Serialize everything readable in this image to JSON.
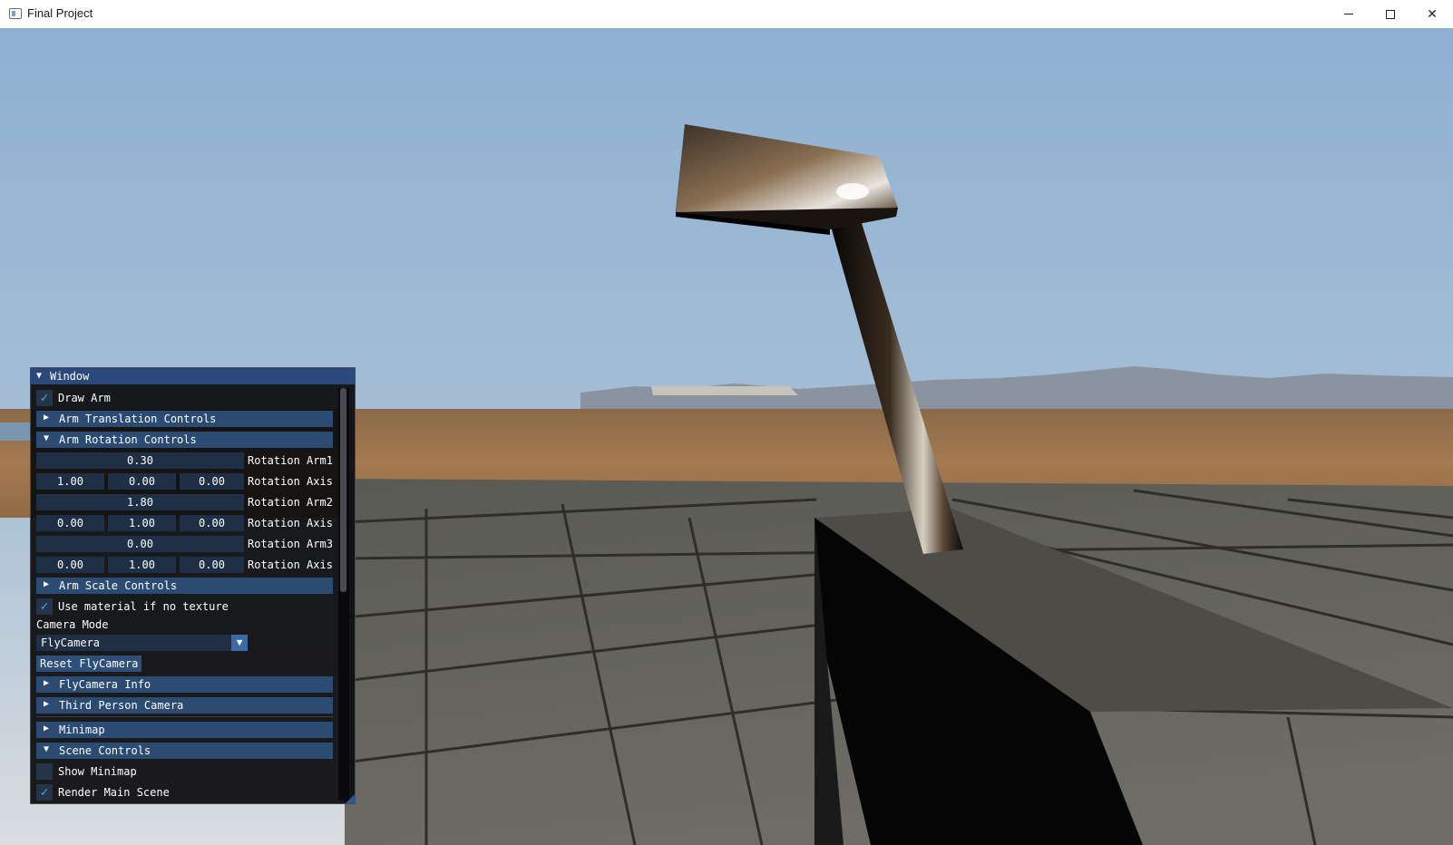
{
  "window": {
    "title": "Final Project",
    "minimize_symbol": "─",
    "maximize_symbol": "☐",
    "close_symbol": "✕"
  },
  "colors": {
    "imgui_header": "#2b4b73",
    "imgui_title": "#294a7a",
    "checkmark": "#4aa3ff",
    "sky_top": "#8fb1d2",
    "sky_horizon": "#d7dce2"
  },
  "imgui": {
    "title": "Window",
    "title_arrow": "▼",
    "draw_arm": {
      "label": "Draw Arm",
      "checked": true,
      "mark": "✓"
    },
    "arm_translation": {
      "label": "Arm Translation Controls",
      "arrow": "▶"
    },
    "arm_rotation": {
      "label": "Arm Rotation Controls",
      "arrow": "▼",
      "rows": [
        {
          "value": "0.30",
          "label": "Rotation Arm1"
        },
        {
          "values": [
            "1.00",
            "0.00",
            "0.00"
          ],
          "label": "Rotation Axis"
        },
        {
          "value": "1.80",
          "label": "Rotation Arm2"
        },
        {
          "values": [
            "0.00",
            "1.00",
            "0.00"
          ],
          "label": "Rotation Axis"
        },
        {
          "value": "0.00",
          "label": "Rotation Arm3"
        },
        {
          "values": [
            "0.00",
            "1.00",
            "0.00"
          ],
          "label": "Rotation Axis"
        }
      ]
    },
    "arm_scale": {
      "label": "Arm Scale Controls",
      "arrow": "▶"
    },
    "use_material": {
      "label": "Use material if no texture",
      "checked": true,
      "mark": "✓"
    },
    "camera_mode": {
      "label": "Camera Mode",
      "value": "FlyCamera",
      "arrow": "▼"
    },
    "reset_button": "Reset FlyCamera",
    "flycamera_info": {
      "label": "FlyCamera Info",
      "arrow": "▶"
    },
    "third_person": {
      "label": "Third Person Camera",
      "arrow": "▶"
    },
    "minimap": {
      "label": "Minimap",
      "arrow": "▶"
    },
    "scene_controls": {
      "label": "Scene Controls",
      "arrow": "▼"
    },
    "show_minimap": {
      "label": "Show Minimap",
      "checked": false
    },
    "render_main": {
      "label": "Render Main Scene",
      "checked": true,
      "mark": "✓"
    }
  }
}
